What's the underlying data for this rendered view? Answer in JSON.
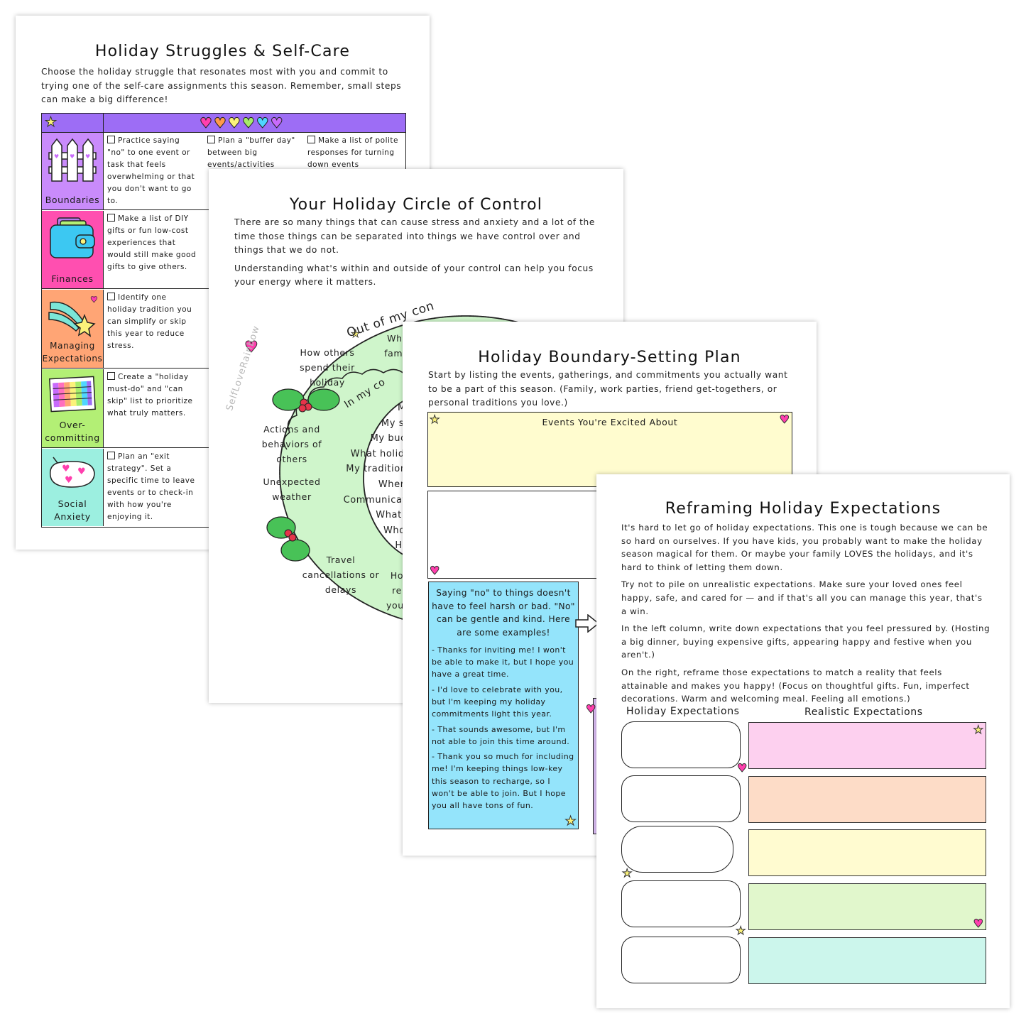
{
  "colors": {
    "purple": "#9d6df5",
    "lilac": "#c98bfb",
    "pink": "#ff4fb0",
    "orange": "#ffa575",
    "green": "#b3ef75",
    "teal": "#9cefe0",
    "blue_note": "#94e4fb",
    "yellow_box": "#fffccf",
    "circle_green": "#cff5cb",
    "rex": [
      "#fdd0ef",
      "#fddcc7",
      "#fffbd0",
      "#e1f7cc",
      "#ccf6ec"
    ]
  },
  "page1": {
    "title": "Holiday Struggles & Self-Care",
    "intro": "Choose the holiday struggle that resonates most with you and commit to trying one of the self-care assignments this season. Remember, small steps can make a big difference!",
    "header_icons": [
      "star-icon",
      "heart-pink",
      "heart-orange",
      "heart-yellow",
      "heart-green",
      "heart-blue",
      "heart-purple"
    ],
    "rows": [
      {
        "label": "Boundaries",
        "icon": "fence-icon",
        "items": [
          "Practice saying \"no\" to one event or task that feels overwhelming or that you don't want to go to.",
          "Plan a \"buffer day\" between big events/activities",
          "Make a list of polite responses for turning down events"
        ]
      },
      {
        "label": "Finances",
        "icon": "wallet-icon",
        "items": [
          "Make a list of DIY gifts or fun low-cost experiences that would still make good gifts to give others."
        ]
      },
      {
        "label": "Managing Expectations",
        "icon": "shooting-star-icon",
        "items": [
          "Identify one holiday tradition you can simplify or skip this year to reduce stress."
        ]
      },
      {
        "label": "Over-committing",
        "icon": "calendar-icon",
        "items": [
          "Create a \"holiday must-do\" and \"can skip\" list to prioritize what truly matters."
        ]
      },
      {
        "label": "Social Anxiety",
        "icon": "speech-bubble-hearts-icon",
        "items": [
          "Plan an \"exit strategy\". Set a specific time to leave events or to check-in with how you're enjoying it."
        ]
      }
    ]
  },
  "page2": {
    "title": "Your Holiday Circle of Control",
    "para1": "There are so many things that can cause stress and anxiety and a lot of the time those things can be separated into things we have control over and things that we do not.",
    "para2": "Understanding what's within and outside of your control can help you focus your energy where it matters.",
    "outer_label": "Out of my con",
    "outer_items": [
      "How others spend their holiday",
      "Actions and behaviors of others",
      "Unexpected weather",
      "Travel cancellations or delays",
      "Whe fam s",
      "Ho re your"
    ],
    "inner_label": "In my co",
    "inner_items": [
      "My",
      "My self",
      "My budge",
      "What holida",
      "My tradition",
      "Where I",
      "Communicati",
      "What tra",
      "Who I s",
      "How I"
    ],
    "watermark": "SelfLoveRainbow"
  },
  "page3": {
    "title": "Holiday Boundary-Setting Plan",
    "intro": "Start by listing the events, gatherings, and commitments you actually want to be a part of this season. (Family, work parties, friend get-togethers, or personal traditions you love.)",
    "excited_label": "Events You're Excited About",
    "note_lead": "Saying \"no\" to things doesn't have to feel harsh or bad. \"No\" can be gentle and kind. Here are some examples!",
    "examples": [
      "- Thanks for inviting me! I won't be able to make it, but I hope you have a great time.",
      "- I'd love to celebrate with you, but I'm keeping my holiday commitments light this year.",
      "- That sounds awesome, but I'm not able to join this time around.",
      "- Thank you so much for including me! I'm keeping things low-key this season to recharge, so I won't be able to join. But I hope you all have tons of fun."
    ]
  },
  "page4": {
    "title": "Reframing Holiday Expectations",
    "paras": [
      "It's hard to let go of holiday expectations. This one is tough because we can be so hard on ourselves. If you have kids, you probably want to make the holiday season magical for them. Or maybe your family LOVES the holidays, and it's hard to think of letting them down.",
      "Try not to pile on unrealistic expectations. Make sure your loved ones feel happy, safe, and cared for — and if that's all you can manage this year, that's a win.",
      "In the left column, write down expectations that you feel pressured by. (Hosting a big dinner, buying expensive gifts, appearing happy and festive when you aren't.)",
      "On the right, reframe those expectations to match a reality that feels attainable and makes you happy! (Focus on thoughtful gifts. Fun, imperfect decorations. Warm and welcoming meal. Feeling all emotions.)"
    ],
    "left_header": "Holiday Expectations",
    "right_header": "Realistic Expectations"
  }
}
